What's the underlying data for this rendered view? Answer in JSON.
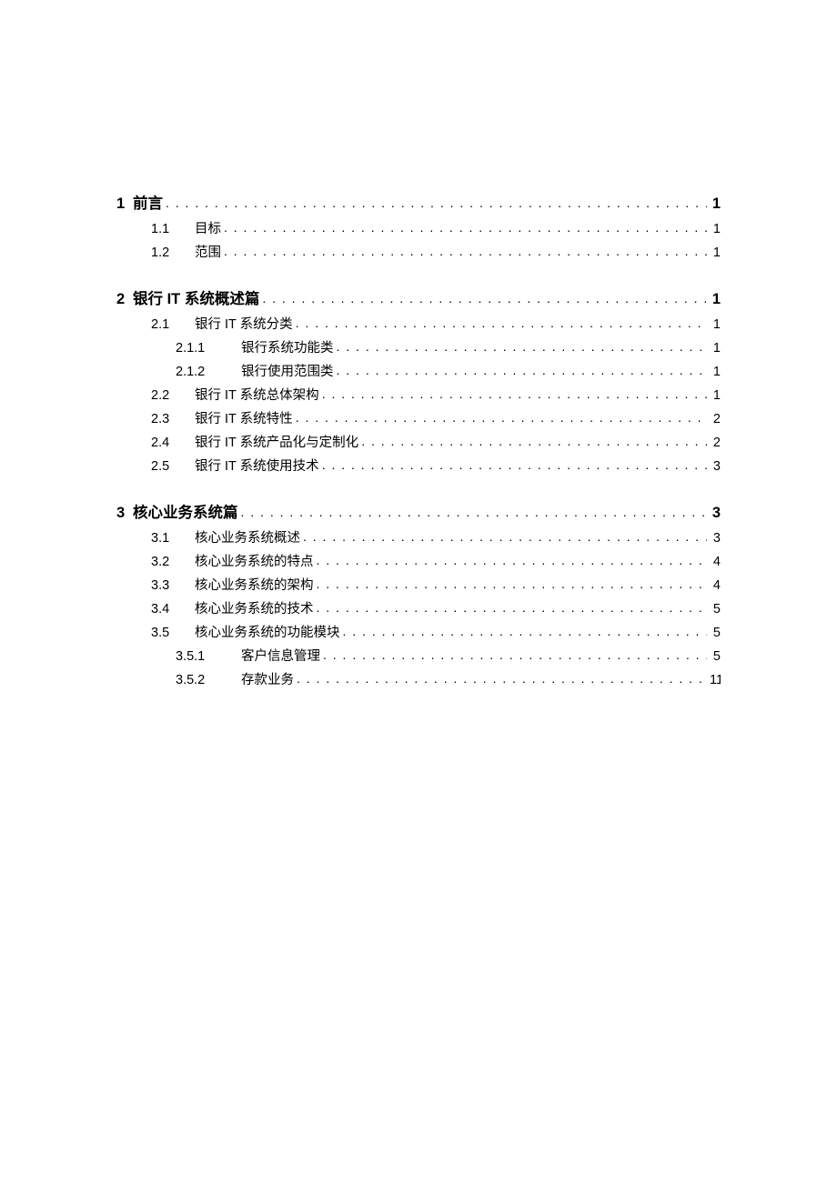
{
  "toc": [
    {
      "level": 1,
      "num": "1",
      "title": "前言",
      "page": "1"
    },
    {
      "level": 2,
      "num": "1.1",
      "title": "目标",
      "page": "1"
    },
    {
      "level": 2,
      "num": "1.2",
      "title": "范围",
      "page": "1"
    },
    {
      "level": 1,
      "num": "2",
      "title": "银行 IT 系统概述篇",
      "page": "1"
    },
    {
      "level": 2,
      "num": "2.1",
      "title": "银行 IT 系统分类",
      "page": "1"
    },
    {
      "level": 3,
      "num": "2.1.1",
      "title": "银行系统功能类",
      "page": "1"
    },
    {
      "level": 3,
      "num": "2.1.2",
      "title": "银行使用范围类",
      "page": "1"
    },
    {
      "level": 2,
      "num": "2.2",
      "title": "银行 IT 系统总体架构",
      "page": "1"
    },
    {
      "level": 2,
      "num": "2.3",
      "title": "银行 IT 系统特性",
      "page": "2"
    },
    {
      "level": 2,
      "num": "2.4",
      "title": "银行 IT 系统产品化与定制化",
      "page": "2"
    },
    {
      "level": 2,
      "num": "2.5",
      "title": "银行 IT 系统使用技术",
      "page": "3"
    },
    {
      "level": 1,
      "num": "3",
      "title": "核心业务系统篇",
      "page": "3"
    },
    {
      "level": 2,
      "num": "3.1",
      "title": "核心业务系统概述",
      "page": "3"
    },
    {
      "level": 2,
      "num": "3.2",
      "title": "核心业务系统的特点",
      "page": "4"
    },
    {
      "level": 2,
      "num": "3.3",
      "title": "核心业务系统的架构",
      "page": "4"
    },
    {
      "level": 2,
      "num": "3.4",
      "title": "核心业务系统的技术",
      "page": "5"
    },
    {
      "level": 2,
      "num": "3.5",
      "title": "核心业务系统的功能模块",
      "page": "5"
    },
    {
      "level": 3,
      "num": "3.5.1",
      "title": "客户信息管理",
      "page": "5"
    },
    {
      "level": 3,
      "num": "3.5.2",
      "title": "存款业务",
      "page": "11"
    }
  ]
}
